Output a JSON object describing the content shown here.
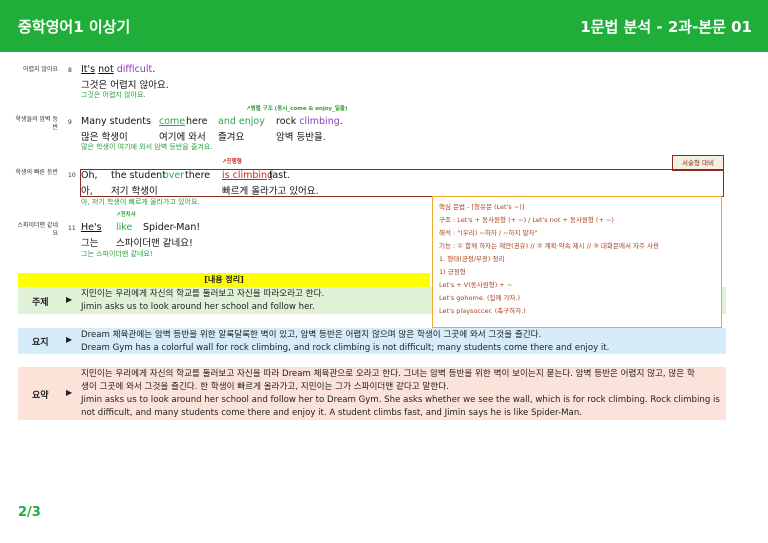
{
  "header": {
    "title": "중학영어1 이상기",
    "section": "1문법 분석 - 2과-본문 01"
  },
  "sentences": [
    {
      "label": "어렵지 않아요",
      "num": "8",
      "en": {
        "w1": "It's",
        "w2": "not",
        "w3": "difficult",
        "w4": "."
      },
      "ko": "그것은 어렵지 않아요.",
      "tr": "그것은 어렵지 않아요."
    },
    {
      "label": "학생들의 암벽 등반",
      "num": "9",
      "note": "병렬 구조 (동시_come & enjoy_일을)",
      "en": {
        "w1": "Many students",
        "w2": "come",
        "w3": "here",
        "w4": "and enjoy",
        "w5": "rock",
        "w6": "climbing",
        "w7": "."
      },
      "ko": {
        "k1": "많은 학생이",
        "k2": "여기에 와서",
        "k3": "즐겨요",
        "k4": "암벽 등반을."
      },
      "tr": "많은 학생이 여기에 와서 암벽 등반을 즐겨요."
    },
    {
      "label": "학생의 빠른 등반",
      "num": "10",
      "note": "진행형",
      "en": {
        "w1": "Oh,",
        "w2": "the student",
        "w3": "over",
        "w4": "there",
        "w5": "is climbing",
        "w6": "fast."
      },
      "ko": {
        "k1": "아,",
        "k2": "저기 학생이",
        "k3": "빠르게 올라가고 있어요."
      },
      "tr": "아, 저기 학생이 빠르게 올라가고 있어요.",
      "tag": "서술형 대비"
    },
    {
      "label": "스파이더맨 같네요",
      "num": "11",
      "note": "전치사",
      "en": {
        "w1": "He's",
        "w2": "like",
        "w3": "Spider-Man!"
      },
      "ko": {
        "k1": "그는",
        "k2": "스파이더맨 같네요!"
      },
      "tr": "그는 스파이더맨 같네요!"
    }
  ],
  "grammar": [
    "핵심 문법 - [청유문 (Let's ~)]",
    "구조 : Let's + 동사원형 (+ ~) / Let's not + 동사원형 (+ ~)",
    "해석 : \"(우리) ~하자 / ~하지 말자\"",
    "기능 : ① 함께 하자는 제안(권유) // ② 계획·약속 제시 // ③ 대화문에서 자주 사용",
    "1. 형태(긍정/부정) 정리",
    "1) 긍정형",
    "Let's + V(동사원형) + ~",
    "Let's gohome. (집에 가자.)",
    "Let's playsoccer. (축구하자.)"
  ],
  "content_header": "[내용 정리]",
  "summary": {
    "topic": {
      "label": "주제",
      "ko": "지민이는 우리에게 자신의 학교를 둘러보고 자신을 따라오라고 한다.",
      "en": "Jimin asks us to look around her school and follow her."
    },
    "gist": {
      "label": "요지",
      "ko": "Dream 체육관에는 암벽 등반을 위한 알록달록한 벽이 있고, 암벽 등반은 어렵지 않으며 많은 학생이 그곳에 와서 그것을 즐긴다.",
      "en": "Dream Gym has a colorful wall for rock climbing, and rock climbing is not difficult; many students come there and enjoy it."
    },
    "abstract": {
      "label": "요약",
      "ko1": "지민이는 우리에게 자신의 학교를 둘러보고 자신을 따라 Dream 체육관으로 오라고 한다. 그녀는 암벽 등반을 위한 벽이 보이는지 묻는다. 암벽 등반은 어렵지 않고, 많은 학",
      "ko2": "생이 그곳에 와서 그것을 즐긴다. 한 학생이 빠르게 올라가고, 지민이는 그가 스파이더맨 같다고 말한다.",
      "en1": "Jimin asks us to look around her school and follow her to Dream Gym. She asks whether we see the wall, which is for rock climbing. Rock climbing is",
      "en2": "not difficult, and many students come there and enjoy it. A student climbs fast, and Jimin says he is like Spider-Man."
    }
  },
  "arrow": "▶",
  "page": "2/3",
  "colors": {
    "header": "#1fae3a",
    "topic_bg": "#dff1d6",
    "gist_bg": "#d6ecf8",
    "abstract_bg": "#fce3da",
    "grammar_border": "#f0a830"
  }
}
